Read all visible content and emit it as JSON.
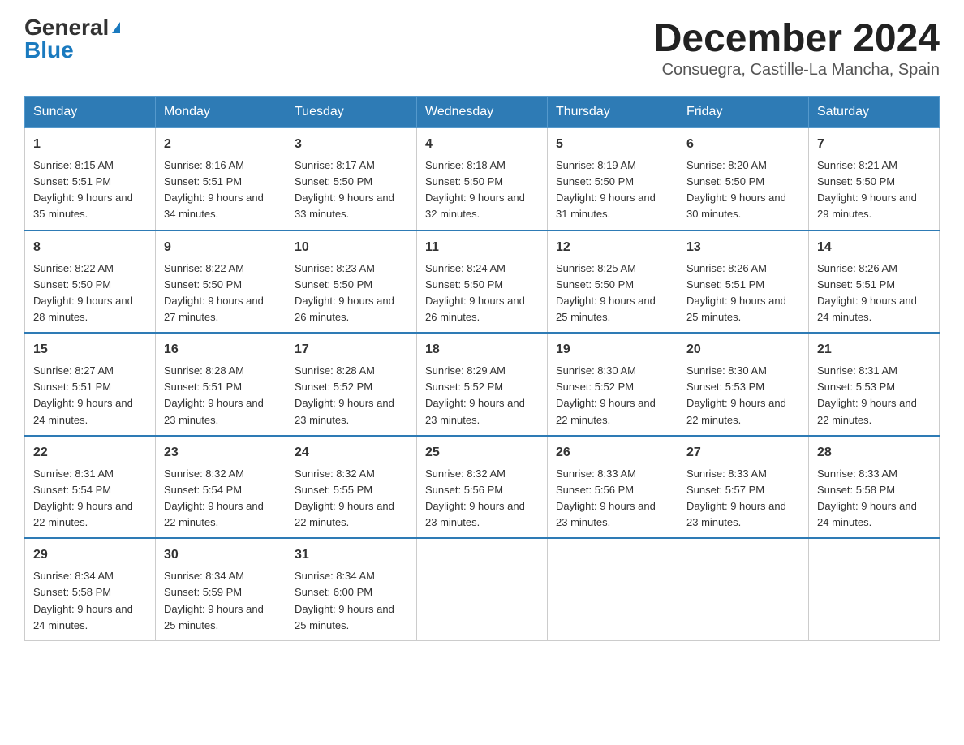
{
  "header": {
    "logo_general": "General",
    "logo_blue": "Blue",
    "month_title": "December 2024",
    "location": "Consuegra, Castille-La Mancha, Spain"
  },
  "weekdays": [
    "Sunday",
    "Monday",
    "Tuesday",
    "Wednesday",
    "Thursday",
    "Friday",
    "Saturday"
  ],
  "weeks": [
    [
      {
        "day": "1",
        "sunrise": "Sunrise: 8:15 AM",
        "sunset": "Sunset: 5:51 PM",
        "daylight": "Daylight: 9 hours and 35 minutes."
      },
      {
        "day": "2",
        "sunrise": "Sunrise: 8:16 AM",
        "sunset": "Sunset: 5:51 PM",
        "daylight": "Daylight: 9 hours and 34 minutes."
      },
      {
        "day": "3",
        "sunrise": "Sunrise: 8:17 AM",
        "sunset": "Sunset: 5:50 PM",
        "daylight": "Daylight: 9 hours and 33 minutes."
      },
      {
        "day": "4",
        "sunrise": "Sunrise: 8:18 AM",
        "sunset": "Sunset: 5:50 PM",
        "daylight": "Daylight: 9 hours and 32 minutes."
      },
      {
        "day": "5",
        "sunrise": "Sunrise: 8:19 AM",
        "sunset": "Sunset: 5:50 PM",
        "daylight": "Daylight: 9 hours and 31 minutes."
      },
      {
        "day": "6",
        "sunrise": "Sunrise: 8:20 AM",
        "sunset": "Sunset: 5:50 PM",
        "daylight": "Daylight: 9 hours and 30 minutes."
      },
      {
        "day": "7",
        "sunrise": "Sunrise: 8:21 AM",
        "sunset": "Sunset: 5:50 PM",
        "daylight": "Daylight: 9 hours and 29 minutes."
      }
    ],
    [
      {
        "day": "8",
        "sunrise": "Sunrise: 8:22 AM",
        "sunset": "Sunset: 5:50 PM",
        "daylight": "Daylight: 9 hours and 28 minutes."
      },
      {
        "day": "9",
        "sunrise": "Sunrise: 8:22 AM",
        "sunset": "Sunset: 5:50 PM",
        "daylight": "Daylight: 9 hours and 27 minutes."
      },
      {
        "day": "10",
        "sunrise": "Sunrise: 8:23 AM",
        "sunset": "Sunset: 5:50 PM",
        "daylight": "Daylight: 9 hours and 26 minutes."
      },
      {
        "day": "11",
        "sunrise": "Sunrise: 8:24 AM",
        "sunset": "Sunset: 5:50 PM",
        "daylight": "Daylight: 9 hours and 26 minutes."
      },
      {
        "day": "12",
        "sunrise": "Sunrise: 8:25 AM",
        "sunset": "Sunset: 5:50 PM",
        "daylight": "Daylight: 9 hours and 25 minutes."
      },
      {
        "day": "13",
        "sunrise": "Sunrise: 8:26 AM",
        "sunset": "Sunset: 5:51 PM",
        "daylight": "Daylight: 9 hours and 25 minutes."
      },
      {
        "day": "14",
        "sunrise": "Sunrise: 8:26 AM",
        "sunset": "Sunset: 5:51 PM",
        "daylight": "Daylight: 9 hours and 24 minutes."
      }
    ],
    [
      {
        "day": "15",
        "sunrise": "Sunrise: 8:27 AM",
        "sunset": "Sunset: 5:51 PM",
        "daylight": "Daylight: 9 hours and 24 minutes."
      },
      {
        "day": "16",
        "sunrise": "Sunrise: 8:28 AM",
        "sunset": "Sunset: 5:51 PM",
        "daylight": "Daylight: 9 hours and 23 minutes."
      },
      {
        "day": "17",
        "sunrise": "Sunrise: 8:28 AM",
        "sunset": "Sunset: 5:52 PM",
        "daylight": "Daylight: 9 hours and 23 minutes."
      },
      {
        "day": "18",
        "sunrise": "Sunrise: 8:29 AM",
        "sunset": "Sunset: 5:52 PM",
        "daylight": "Daylight: 9 hours and 23 minutes."
      },
      {
        "day": "19",
        "sunrise": "Sunrise: 8:30 AM",
        "sunset": "Sunset: 5:52 PM",
        "daylight": "Daylight: 9 hours and 22 minutes."
      },
      {
        "day": "20",
        "sunrise": "Sunrise: 8:30 AM",
        "sunset": "Sunset: 5:53 PM",
        "daylight": "Daylight: 9 hours and 22 minutes."
      },
      {
        "day": "21",
        "sunrise": "Sunrise: 8:31 AM",
        "sunset": "Sunset: 5:53 PM",
        "daylight": "Daylight: 9 hours and 22 minutes."
      }
    ],
    [
      {
        "day": "22",
        "sunrise": "Sunrise: 8:31 AM",
        "sunset": "Sunset: 5:54 PM",
        "daylight": "Daylight: 9 hours and 22 minutes."
      },
      {
        "day": "23",
        "sunrise": "Sunrise: 8:32 AM",
        "sunset": "Sunset: 5:54 PM",
        "daylight": "Daylight: 9 hours and 22 minutes."
      },
      {
        "day": "24",
        "sunrise": "Sunrise: 8:32 AM",
        "sunset": "Sunset: 5:55 PM",
        "daylight": "Daylight: 9 hours and 22 minutes."
      },
      {
        "day": "25",
        "sunrise": "Sunrise: 8:32 AM",
        "sunset": "Sunset: 5:56 PM",
        "daylight": "Daylight: 9 hours and 23 minutes."
      },
      {
        "day": "26",
        "sunrise": "Sunrise: 8:33 AM",
        "sunset": "Sunset: 5:56 PM",
        "daylight": "Daylight: 9 hours and 23 minutes."
      },
      {
        "day": "27",
        "sunrise": "Sunrise: 8:33 AM",
        "sunset": "Sunset: 5:57 PM",
        "daylight": "Daylight: 9 hours and 23 minutes."
      },
      {
        "day": "28",
        "sunrise": "Sunrise: 8:33 AM",
        "sunset": "Sunset: 5:58 PM",
        "daylight": "Daylight: 9 hours and 24 minutes."
      }
    ],
    [
      {
        "day": "29",
        "sunrise": "Sunrise: 8:34 AM",
        "sunset": "Sunset: 5:58 PM",
        "daylight": "Daylight: 9 hours and 24 minutes."
      },
      {
        "day": "30",
        "sunrise": "Sunrise: 8:34 AM",
        "sunset": "Sunset: 5:59 PM",
        "daylight": "Daylight: 9 hours and 25 minutes."
      },
      {
        "day": "31",
        "sunrise": "Sunrise: 8:34 AM",
        "sunset": "Sunset: 6:00 PM",
        "daylight": "Daylight: 9 hours and 25 minutes."
      },
      null,
      null,
      null,
      null
    ]
  ]
}
